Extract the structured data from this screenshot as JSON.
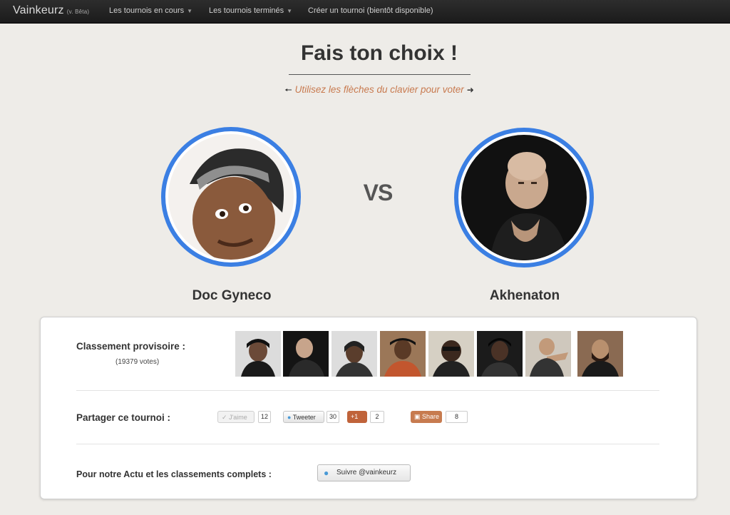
{
  "navbar": {
    "brand": "Vainkeurz",
    "brand_note": "(v. Bêta)",
    "items": [
      {
        "label": "Les tournois en cours",
        "dropdown": true
      },
      {
        "label": "Les tournois terminés",
        "dropdown": true
      },
      {
        "label": "Créer un tournoi (bientôt disponible)",
        "dropdown": false
      }
    ]
  },
  "heading": {
    "title": "Fais ton choix !",
    "subtitle": "Utilisez les flèches du clavier pour voter"
  },
  "duel": {
    "left": {
      "name": "Doc Gyneco"
    },
    "vs": "VS",
    "right": {
      "name": "Akhenaton"
    }
  },
  "panel": {
    "ranking": {
      "label": "Classement provisoire :",
      "votes": "(19379 votes)",
      "thumbnails": 8
    },
    "share": {
      "label": "Partager ce tournoi :",
      "like": {
        "label": "J'aime",
        "count": "12"
      },
      "tweet": {
        "label": "Tweeter",
        "count": "30"
      },
      "gplus": {
        "label": "+1",
        "count": "2"
      },
      "share": {
        "label": "Share",
        "count": "8"
      }
    },
    "follow": {
      "label": "Pour notre Actu et les classements complets :",
      "button": "Suivre @vainkeurz"
    }
  },
  "colors": {
    "accent_ring": "#3b7fe3",
    "subtitle": "#c87a4f",
    "navbar": "#222222"
  }
}
